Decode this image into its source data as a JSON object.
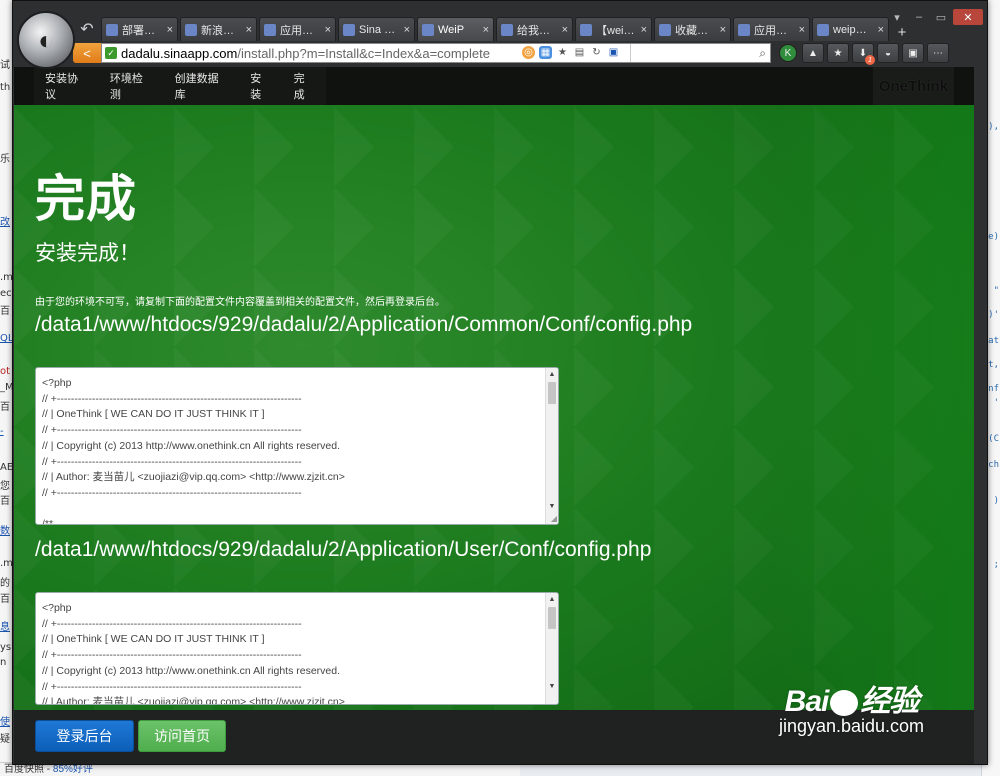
{
  "browser": {
    "tabs": [
      {
        "label": "部署…",
        "icon": "document-icon"
      },
      {
        "label": "新浪…",
        "icon": "sina-icon"
      },
      {
        "label": "应用…",
        "icon": "page-icon"
      },
      {
        "label": "Sina …",
        "icon": "page-icon"
      },
      {
        "label": "WeiP",
        "icon": "page-icon",
        "active": true
      },
      {
        "label": "给我…",
        "icon": "page-icon"
      },
      {
        "label": "【wei…",
        "icon": "page-icon"
      },
      {
        "label": "收藏…",
        "icon": "star-icon"
      },
      {
        "label": "应用…",
        "icon": "page-icon"
      },
      {
        "label": "weip…",
        "icon": "page-icon"
      }
    ],
    "url_host": "dadalu.sinaapp.com",
    "url_path": "/install.php?m=Install&c=Index&a=complete",
    "ext_icon_k": "K",
    "download_badge": "1"
  },
  "nav": {
    "items": [
      "安装协议",
      "环境检测",
      "创建数据库",
      "安装",
      "完成"
    ],
    "brand": "OneThink"
  },
  "main": {
    "title": "完成",
    "subtitle": "安装完成！",
    "notice": "由于您的环境不可写，请复制下面的配置文件内容覆盖到相关的配置文件，然后再登录后台。",
    "files": [
      {
        "path": "/data1/www/htdocs/929/dadalu/2/Application/Common/Conf/config.php",
        "code": "<?php\n// +----------------------------------------------------------------------\n// | OneThink [ WE CAN DO IT JUST THINK IT ]\n// +----------------------------------------------------------------------\n// | Copyright (c) 2013 http://www.onethink.cn All rights reserved.\n// +----------------------------------------------------------------------\n// | Author: 麦当苗儿 <zuojiazi@vip.qq.com> <http://www.zjzit.cn>\n// +----------------------------------------------------------------------\n\n/**"
      },
      {
        "path": "/data1/www/htdocs/929/dadalu/2/Application/User/Conf/config.php",
        "code": "<?php\n// +----------------------------------------------------------------------\n// | OneThink [ WE CAN DO IT JUST THINK IT ]\n// +----------------------------------------------------------------------\n// | Copyright (c) 2013 http://www.onethink.cn All rights reserved.\n// +----------------------------------------------------------------------\n// | Author: 麦当苗儿 <zuojiazi@vip.qq.com> <http://www.zjzit.cn>"
      }
    ]
  },
  "footer": {
    "admin_button": "登录后台",
    "home_button": "访问首页"
  },
  "watermark": {
    "top": "Bai",
    "top_suffix": "经验",
    "bottom": "jingyan.baidu.com"
  },
  "background": {
    "bottom_text": "百度快照",
    "bottom_link": "85%好评"
  }
}
